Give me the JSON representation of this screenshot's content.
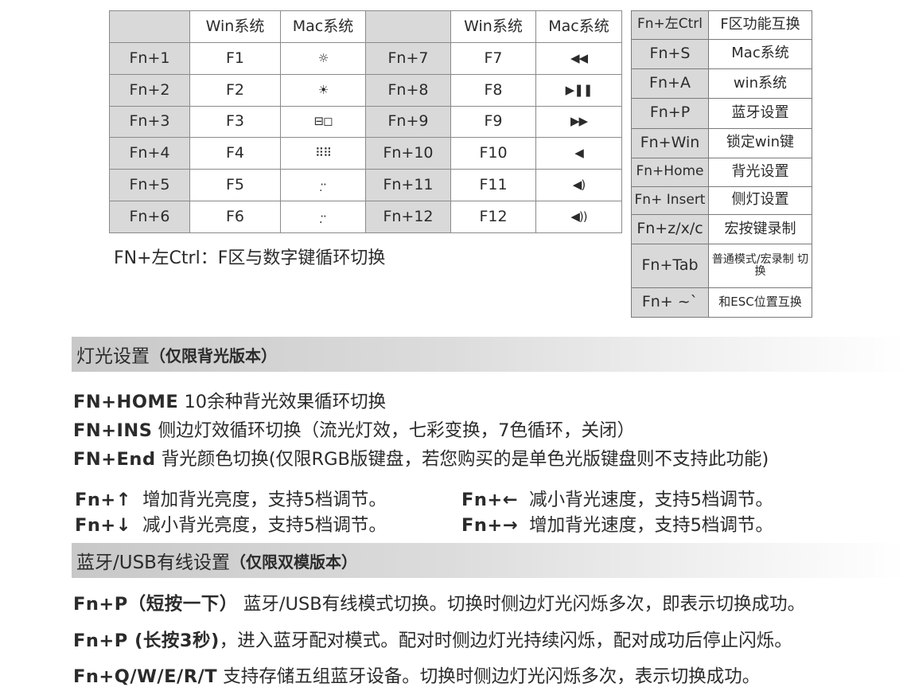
{
  "fn_table": {
    "header": [
      "",
      "Win系统",
      "Mac系统",
      "",
      "Win系统",
      "Mac系统"
    ],
    "rows": [
      [
        "Fn+1",
        "F1",
        "☼",
        "Fn+7",
        "F7",
        "◀◀"
      ],
      [
        "Fn+2",
        "F2",
        "☀",
        "Fn+8",
        "F8",
        "▶❚❚"
      ],
      [
        "Fn+3",
        "F3",
        "⊟◻",
        "Fn+9",
        "F9",
        "▶▶"
      ],
      [
        "Fn+4",
        "F4",
        "⠿⠿",
        "Fn+10",
        "F10",
        "◀"
      ],
      [
        "Fn+5",
        "F5",
        "·̣·",
        "Fn+11",
        "F11",
        "◀)"
      ],
      [
        "Fn+6",
        "F6",
        "·̣̣·",
        "Fn+12",
        "F12",
        "◀))"
      ]
    ]
  },
  "fn_note": "FN+左Ctrl：F区与数字键循环切换",
  "side_table": [
    {
      "key": "Fn+左Ctrl",
      "value": "F区功能互换"
    },
    {
      "key": "Fn+S",
      "value": "Mac系统"
    },
    {
      "key": "Fn+A",
      "value": "win系统"
    },
    {
      "key": "Fn+P",
      "value": "蓝牙设置"
    },
    {
      "key": "Fn+Win",
      "value": "锁定win键"
    },
    {
      "key": "Fn+Home",
      "value": "背光设置"
    },
    {
      "key": "Fn+ Insert",
      "value": "侧灯设置"
    },
    {
      "key": "Fn+z/x/c",
      "value": "宏按键录制"
    },
    {
      "key": "Fn+Tab",
      "value": "普通模式/宏录制 切换"
    },
    {
      "key": "Fn+ ~`",
      "value": "和ESC位置互换"
    }
  ],
  "lighting": {
    "title": "灯光设置",
    "title_bold": "（仅限背光版本）",
    "lines": [
      {
        "key": "FN+HOME",
        "text": "10余种背光效果循环切换"
      },
      {
        "key": "FN+INS",
        "text": "侧边灯效循环切换（流光灯效，七彩变换，7色循环，关闭）"
      },
      {
        "key": "FN+End",
        "text": "背光颜色切换(仅限RGB版键盘，若您购买的是单色光版键盘则不支持此功能)"
      }
    ],
    "arrows": [
      {
        "key": "Fn+↑",
        "text": "增加背光亮度，支持5档调节。"
      },
      {
        "key": "Fn+↓",
        "text": "减小背光亮度，支持5档调节。"
      },
      {
        "key": "Fn+←",
        "text": "减小背光速度，支持5档调节。"
      },
      {
        "key": "Fn+→",
        "text": "增加背光速度，支持5档调节。"
      }
    ]
  },
  "bluetooth": {
    "title": "蓝牙/USB有线设置",
    "title_bold": "（仅限双模版本）",
    "lines": [
      {
        "key": "Fn+P（短按一下）",
        "text": "蓝牙/USB有线模式切换。切换时侧边灯光闪烁多次，即表示切换成功。"
      },
      {
        "key": "Fn+P (长按3秒)",
        "text": "，进入蓝牙配对模式。配对时侧边灯光持续闪烁，配对成功后停止闪烁。"
      },
      {
        "key": "Fn+Q/W/E/R/T",
        "text": "支持存储五组蓝牙设备。切换时侧边灯光闪烁多次，表示切换成功。"
      }
    ]
  }
}
